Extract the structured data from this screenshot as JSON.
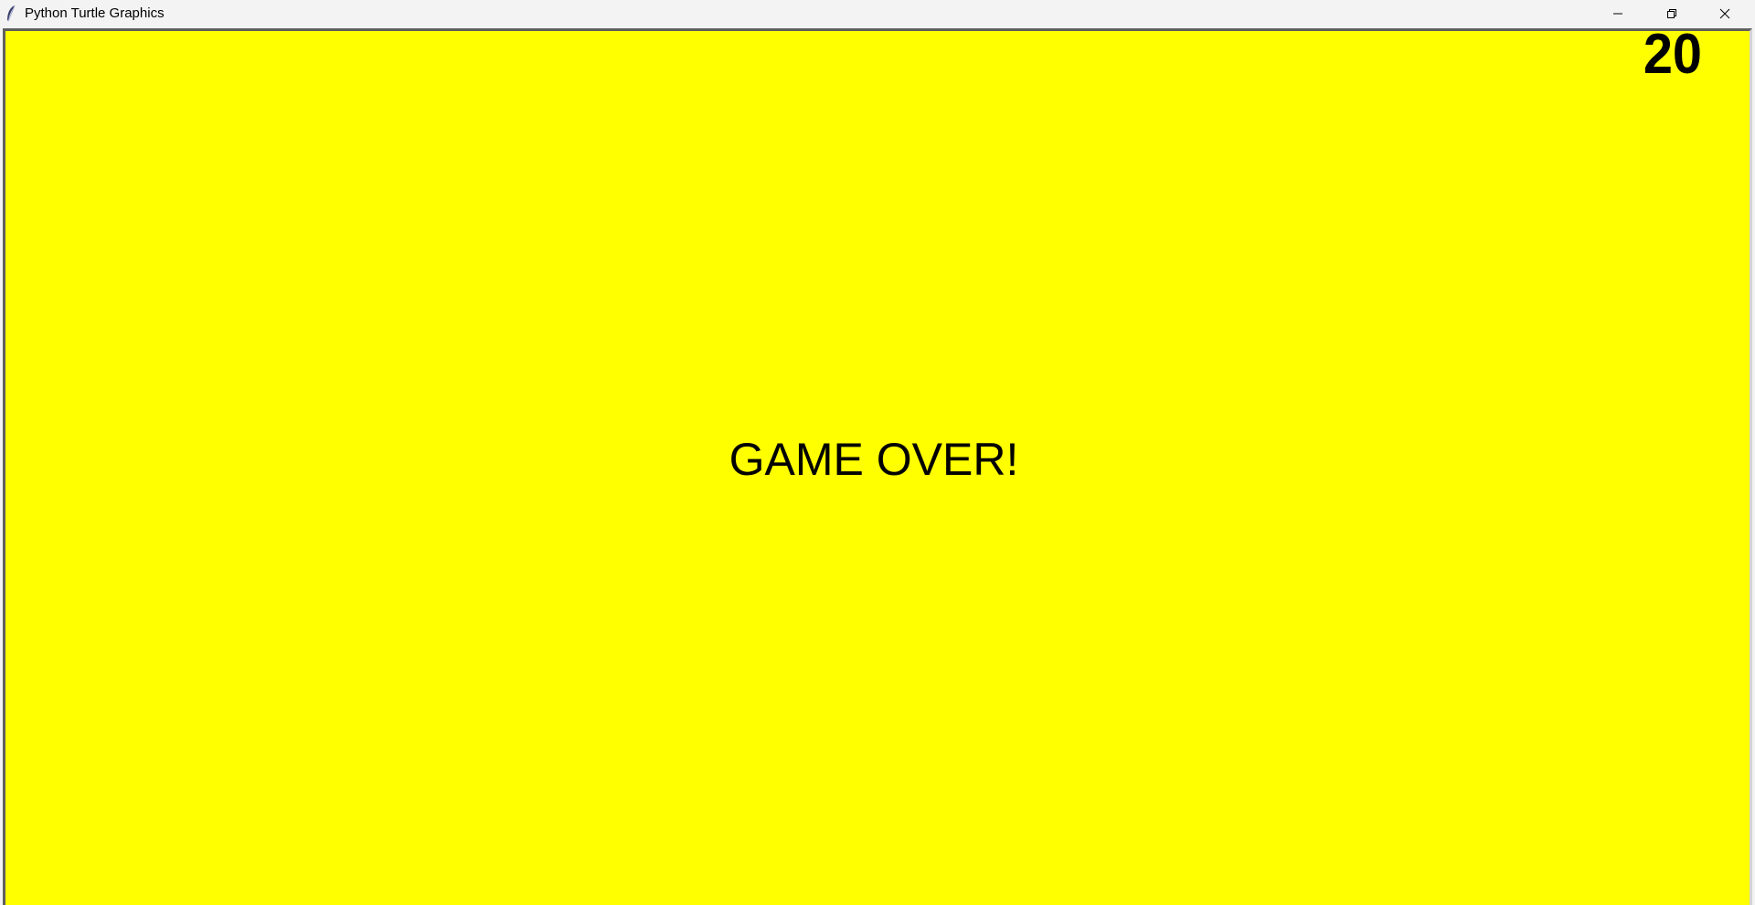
{
  "window": {
    "title": "Python Turtle Graphics",
    "icon": "feather-icon",
    "controls": {
      "minimize_icon": "minimize-icon",
      "restore_icon": "restore-icon",
      "close_icon": "close-icon"
    }
  },
  "game": {
    "background_color": "#ffff00",
    "score": "20",
    "message": "GAME OVER!"
  }
}
